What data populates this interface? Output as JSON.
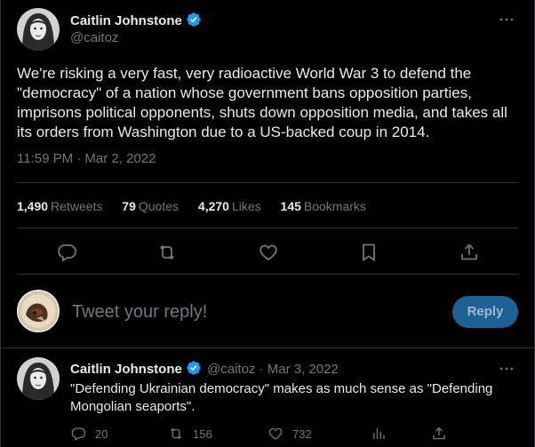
{
  "main_tweet": {
    "author_name": "Caitlin Johnstone",
    "handle": "@caitoz",
    "text": "We're risking a very fast, very radioactive World War 3 to defend the \"democracy\" of a nation whose government bans opposition parties, imprisons political opponents, shuts down opposition media, and takes all its orders from Washington due to a US-backed coup in 2014.",
    "timestamp": "11:59 PM · Mar 2, 2022",
    "stats": {
      "retweets_count": "1,490",
      "retweets_label": "Retweets",
      "quotes_count": "79",
      "quotes_label": "Quotes",
      "likes_count": "4,270",
      "likes_label": "Likes",
      "bookmarks_count": "145",
      "bookmarks_label": "Bookmarks"
    },
    "icons": [
      "reply-icon",
      "retweet-icon",
      "like-icon",
      "bookmark-icon",
      "share-icon"
    ]
  },
  "composer": {
    "placeholder": "Tweet your reply!",
    "button_label": "Reply",
    "button_color": "#1d6294"
  },
  "reply_tweet": {
    "author_name": "Caitlin Johnstone",
    "meta": "@caitoz · Mar 3, 2022",
    "text": "\"Defending Ukrainian democracy\" makes as much sense as \"Defending Mongolian seaports\".",
    "replies": "20",
    "retweets": "156",
    "likes": "732"
  },
  "colors": {
    "background": "#000000",
    "text_primary": "#e7e9ea",
    "text_secondary": "#71767b",
    "divider": "#2f3336",
    "verified_badge": "#1d9bf0"
  }
}
